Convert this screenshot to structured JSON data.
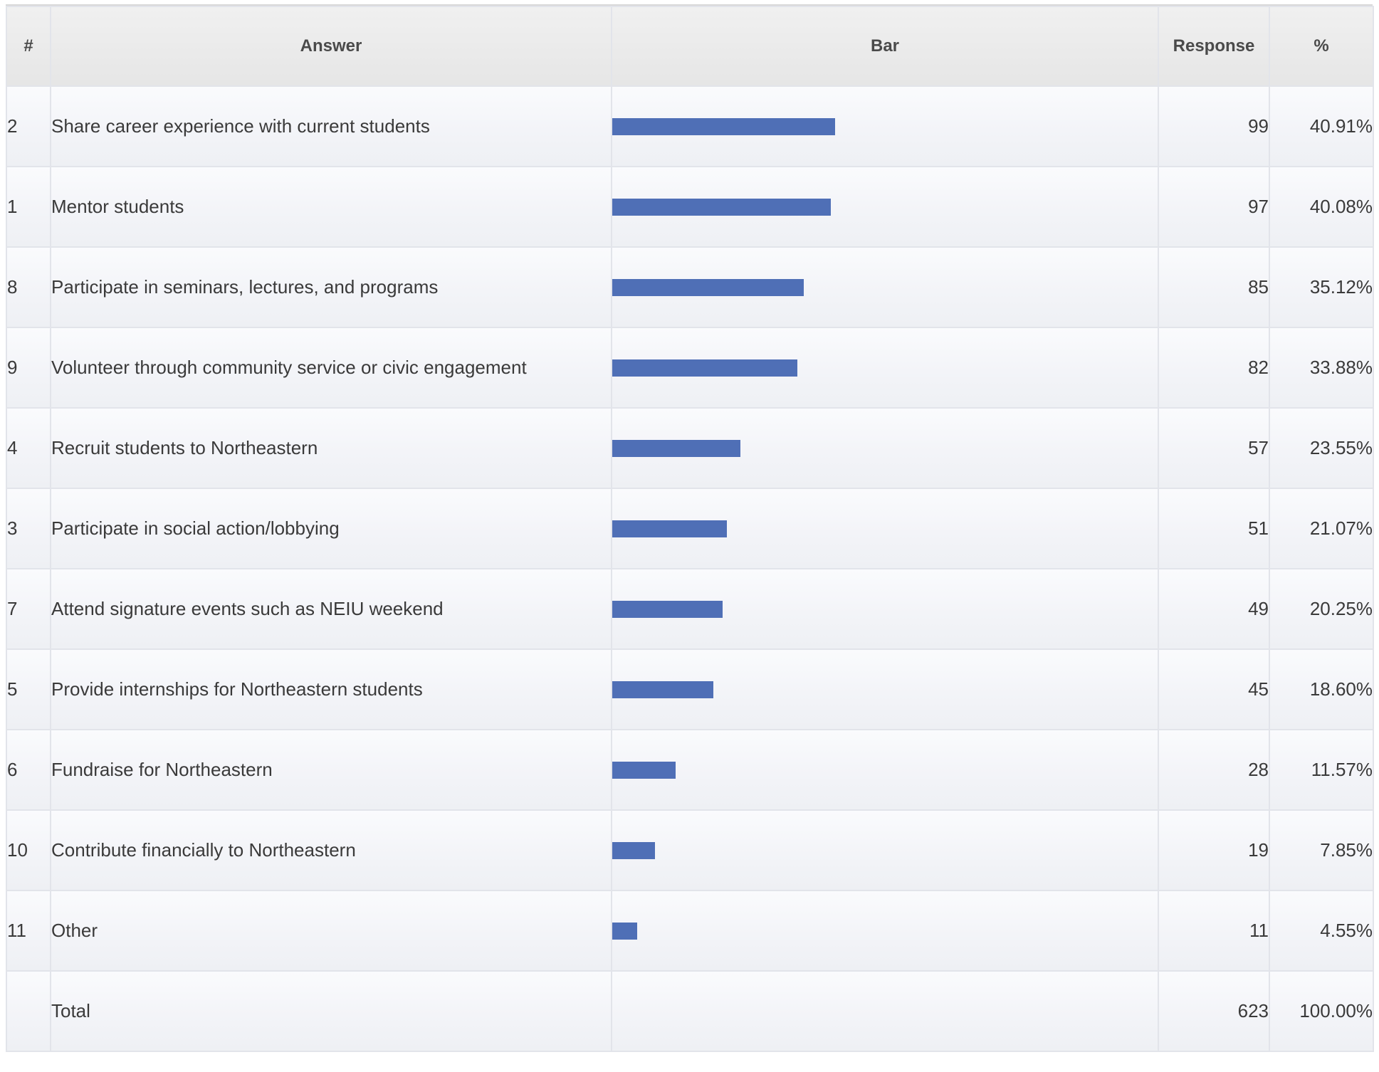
{
  "table": {
    "headers": {
      "num": "#",
      "answer": "Answer",
      "bar": "Bar",
      "response": "Response",
      "pct": "%"
    },
    "rows": [
      {
        "num": "2",
        "answer": "Share career experience with current students",
        "response": "99",
        "pct": "40.91%",
        "value": 40.91
      },
      {
        "num": "1",
        "answer": "Mentor students",
        "response": "97",
        "pct": "40.08%",
        "value": 40.08
      },
      {
        "num": "8",
        "answer": "Participate in seminars, lectures, and programs",
        "response": "85",
        "pct": "35.12%",
        "value": 35.12
      },
      {
        "num": "9",
        "answer": "Volunteer through community service or civic engagement",
        "response": "82",
        "pct": "33.88%",
        "value": 33.88
      },
      {
        "num": "4",
        "answer": "Recruit students to Northeastern",
        "response": "57",
        "pct": "23.55%",
        "value": 23.55
      },
      {
        "num": "3",
        "answer": "Participate in social action/lobbying",
        "response": "51",
        "pct": "21.07%",
        "value": 21.07
      },
      {
        "num": "7",
        "answer": "Attend signature events such as NEIU weekend",
        "response": "49",
        "pct": "20.25%",
        "value": 20.25
      },
      {
        "num": "5",
        "answer": "Provide internships for Northeastern students",
        "response": "45",
        "pct": "18.60%",
        "value": 18.6
      },
      {
        "num": "6",
        "answer": "Fundraise for Northeastern",
        "response": "28",
        "pct": "11.57%",
        "value": 11.57
      },
      {
        "num": "10",
        "answer": "Contribute financially to Northeastern",
        "response": "19",
        "pct": "7.85%",
        "value": 7.85
      },
      {
        "num": "11",
        "answer": "Other",
        "response": "11",
        "pct": "4.55%",
        "value": 4.55
      }
    ],
    "total": {
      "num": "",
      "answer": "Total",
      "response": "623",
      "pct": "100.00%"
    },
    "bar_color": "#4f6fb6"
  }
}
